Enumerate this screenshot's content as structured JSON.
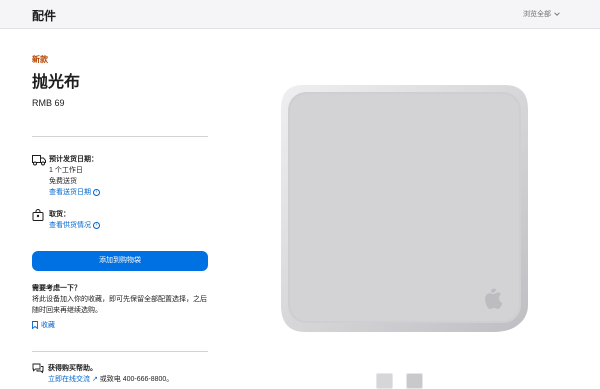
{
  "header": {
    "title": "配件",
    "browse_label": "浏览全部"
  },
  "product": {
    "badge": "新款",
    "name": "抛光布",
    "price": "RMB 69"
  },
  "shipping": {
    "heading": "预计发货日期：",
    "days": "1 个工作日",
    "free": "免费送货",
    "link": "查看送货日期"
  },
  "pickup": {
    "heading": "取货：",
    "link": "查看供货情况"
  },
  "cart_button": "添加到购物袋",
  "consider": {
    "question": "需要考虑一下？",
    "line1": "将此设备加入你的收藏，即可先保留全部配置选择，之后",
    "line2": "随时回来再继续选购。",
    "save_link": "收藏"
  },
  "help": {
    "heading": "获得购买帮助。",
    "chat_link": "立即在线交流",
    "phone_text": "或致电 400-666-8800。"
  },
  "gallery": {
    "thumb_count": 2,
    "selected_index": 1
  },
  "colors": {
    "accent": "#0071e3",
    "link": "#0066cc",
    "badge": "#b64400"
  }
}
